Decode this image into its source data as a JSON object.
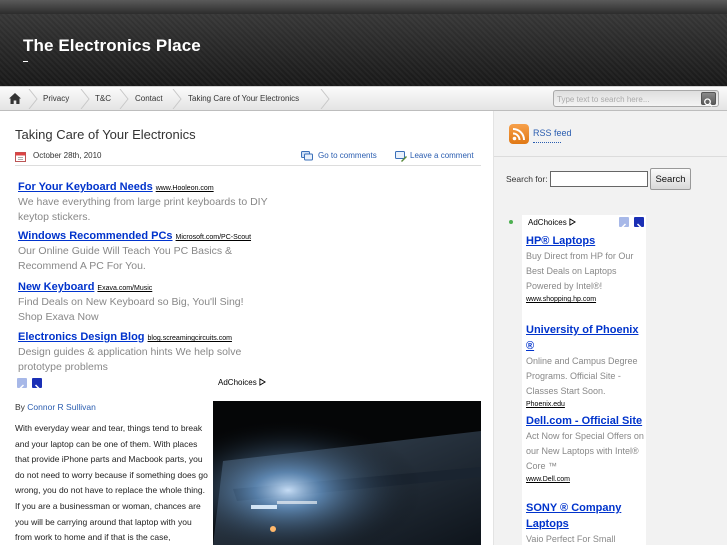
{
  "site": {
    "title": "The Electronics Place"
  },
  "nav": {
    "items": [
      "Privacy",
      "T&C",
      "Contact",
      "Taking Care of Your Electronics"
    ],
    "search_placeholder": "Type text to search here...",
    "home_icon": "home-icon",
    "search_icon": "magnifier-icon"
  },
  "post": {
    "title": "Taking Care of Your Electronics",
    "date": "October 28th, 2010",
    "goto_comments": "Go to comments",
    "leave_comment": "Leave a comment",
    "byline_prefix": "By",
    "author": "Connor R Sullivan",
    "body": "With everyday wear and tear, things tend to break and your laptop can be one of them. With places that provide iPhone parts and Macbook parts, you do not need to worry because if something does go wrong, you do not have to replace the whole thing. If you are a businessman or woman, chances are you will be carrying around that laptop with you from work to home and if that is the case,"
  },
  "ads": [
    {
      "title": "For Your Keyboard Needs",
      "url": "www.Hooleon.com",
      "desc": "We have everything from large print keyboards to DIY keytop stickers."
    },
    {
      "title": "Windows Recommended PCs",
      "url": "Microsoft.com/PC-Scout",
      "desc": "Our Online Guide Will Teach You PC Basics & Recommend A PC For You."
    },
    {
      "title": "New Keyboard",
      "url": "Exava.com/Music",
      "desc": "Find Deals on New Keyboard so Big, You'll Sing! Shop Exava Now"
    },
    {
      "title": "Electronics Design Blog",
      "url": "blog.screamingcircuits.com",
      "desc": "Design guides & application hints We help solve prototype problems"
    }
  ],
  "adchoices_label": "AdChoices",
  "sidebar": {
    "rss_label": "RSS feed",
    "search_label": "Search for:",
    "search_button": "Search",
    "ads": [
      {
        "title": "HP® Laptops",
        "desc": "Buy Direct from HP for Our Best Deals on Laptops Powered by Intel®!",
        "url": "www.shopping.hp.com"
      },
      {
        "title": "University of Phoenix ®",
        "desc": "Online and Campus Degree Programs. Official Site - Classes Start Soon.",
        "url": "Phoenix.edu"
      },
      {
        "title": "Dell.com - Official Site",
        "desc": "Act Now for Special Offers on our New Laptops with Intel® Core ™",
        "url": "www.Dell.com"
      },
      {
        "title": "SONY ® Company Laptops",
        "desc": "Vaio Perfect For Small",
        "url": ""
      }
    ]
  },
  "colors": {
    "link": "#2a5db0",
    "ad_link": "#0033cc",
    "ad_text": "#888888",
    "header_dark": "#181818",
    "rss_orange": "#f08a24"
  }
}
